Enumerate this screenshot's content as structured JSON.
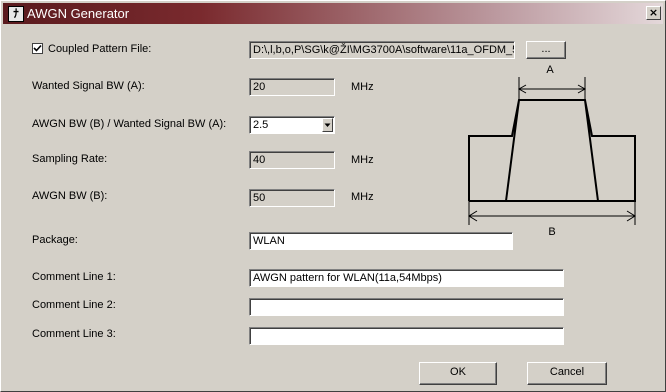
{
  "window": {
    "title": "AWGN Generator",
    "close_glyph": "×",
    "app_icon_glyph": "ﾅ"
  },
  "form": {
    "coupled_pattern": {
      "label": "Coupled Pattern File:",
      "checked": true,
      "path": "D:\\,l,b,o,P\\SG\\k@ŽI\\MG3700A\\software\\11a_OFDM_5",
      "browse_label": "..."
    },
    "wanted_signal_bw": {
      "label": "Wanted Signal BW (A):",
      "value": "20",
      "unit": "MHz"
    },
    "awgn_ratio": {
      "label": "AWGN BW (B) / Wanted Signal BW (A):",
      "selected": "2.5"
    },
    "sampling_rate": {
      "label": "Sampling Rate:",
      "value": "40",
      "unit": "MHz"
    },
    "awgn_bw": {
      "label": "AWGN BW (B):",
      "value": "50",
      "unit": "MHz"
    },
    "package": {
      "label": "Package:",
      "value": "WLAN"
    },
    "comment1": {
      "label": "Comment Line 1:",
      "value": "AWGN pattern for WLAN(11a,54Mbps)"
    },
    "comment2": {
      "label": "Comment Line 2:",
      "value": ""
    },
    "comment3": {
      "label": "Comment Line 3:",
      "value": ""
    }
  },
  "diagram": {
    "label_a": "A",
    "label_b": "B"
  },
  "buttons": {
    "ok": "OK",
    "cancel": "Cancel"
  }
}
